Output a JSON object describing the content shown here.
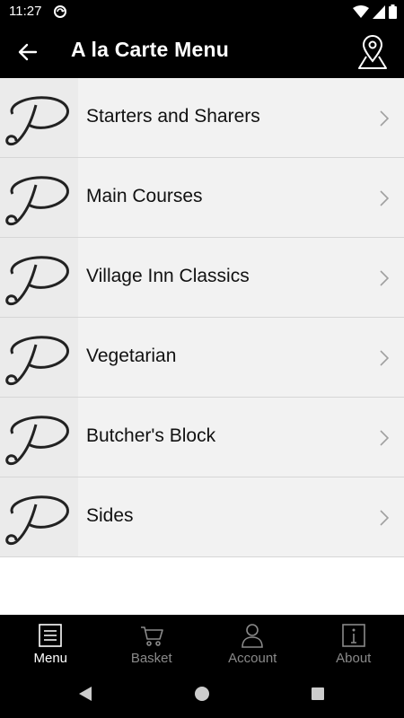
{
  "status_bar": {
    "time": "11:27",
    "icons": [
      "sync-icon",
      "wifi-icon",
      "signal-icon",
      "battery-icon"
    ]
  },
  "app_bar": {
    "title": "A la Carte Menu",
    "back_icon": "arrow-left-icon",
    "location_icon": "map-pin-icon"
  },
  "categories": [
    {
      "label": "Starters and Sharers",
      "logo_letter": "P"
    },
    {
      "label": "Main Courses",
      "logo_letter": "P"
    },
    {
      "label": "Village Inn Classics",
      "logo_letter": "P"
    },
    {
      "label": "Vegetarian",
      "logo_letter": "P"
    },
    {
      "label": "Butcher's Block",
      "logo_letter": "P"
    },
    {
      "label": "Sides",
      "logo_letter": "P"
    }
  ],
  "tab_bar": {
    "active": "Menu",
    "tabs": [
      {
        "label": "Menu",
        "icon": "menu-list-icon"
      },
      {
        "label": "Basket",
        "icon": "cart-icon"
      },
      {
        "label": "Account",
        "icon": "person-icon"
      },
      {
        "label": "About",
        "icon": "info-icon"
      }
    ]
  },
  "colors": {
    "bar_background": "#000000",
    "row_background": "#f2f2f2",
    "tab_active": "#ffffff",
    "tab_inactive": "#8a8a8a"
  }
}
